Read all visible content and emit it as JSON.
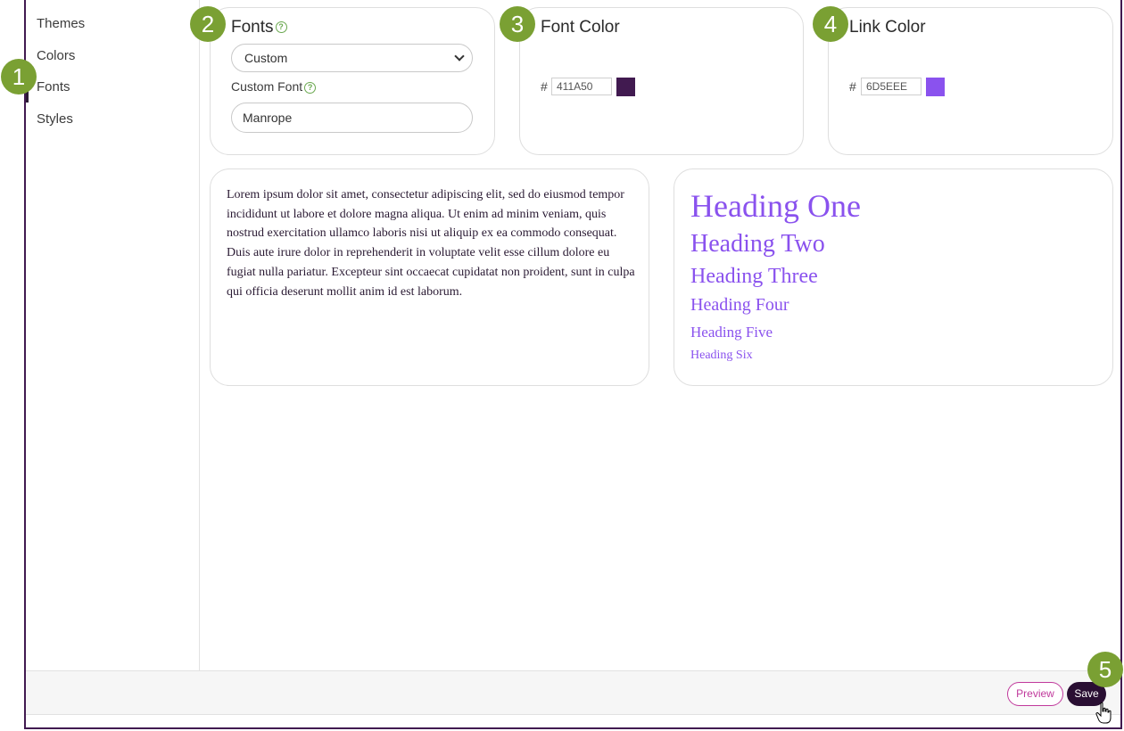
{
  "sidebar": {
    "items": [
      {
        "label": "Themes"
      },
      {
        "label": "Colors"
      },
      {
        "label": "Fonts"
      },
      {
        "label": "Styles"
      }
    ]
  },
  "fonts_card": {
    "title": "Fonts",
    "select_value": "Custom",
    "custom_font_label": "Custom Font",
    "custom_font_value": "Manrope"
  },
  "font_color_card": {
    "title": "Font Color",
    "hash": "#",
    "hex": "411A50",
    "swatch_color": "#411A50"
  },
  "link_color_card": {
    "title": "Link Color",
    "hash": "#",
    "hex": "6D5EEE",
    "swatch_color": "#8A52EE"
  },
  "preview_text": {
    "body": "Lorem ipsum dolor sit amet, consectetur adipiscing elit, sed do eiusmod tempor incididunt ut labore et dolore magna aliqua. Ut enim ad minim veniam, quis nostrud exercitation ullamco laboris nisi ut aliquip ex ea commodo consequat. Duis aute irure dolor in reprehenderit in voluptate velit esse cillum dolore eu fugiat nulla pariatur. Excepteur sint occaecat cupidatat non proident, sunt in culpa qui officia deserunt mollit anim id est laborum."
  },
  "preview_headings": {
    "h1": "Heading One",
    "h2": "Heading Two",
    "h3": "Heading Three",
    "h4": "Heading Four",
    "h5": "Heading Five",
    "h6": "Heading Six",
    "color": "#8A52EE"
  },
  "footer": {
    "preview_label": "Preview",
    "save_label": "Save"
  },
  "badges": [
    "1",
    "2",
    "3",
    "4",
    "5"
  ],
  "colors": {
    "accent_dark": "#411A50",
    "badge_green": "#7AA033",
    "help_green": "#6AA84F",
    "preview_pink": "#C0399C"
  }
}
